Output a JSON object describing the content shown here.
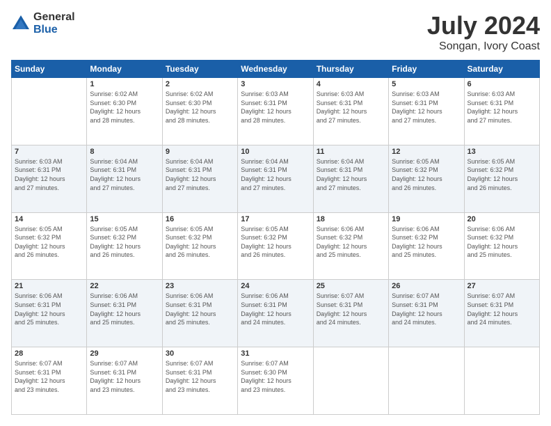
{
  "logo": {
    "general": "General",
    "blue": "Blue"
  },
  "title": "July 2024",
  "subtitle": "Songan, Ivory Coast",
  "weekdays": [
    "Sunday",
    "Monday",
    "Tuesday",
    "Wednesday",
    "Thursday",
    "Friday",
    "Saturday"
  ],
  "weeks": [
    [
      {
        "day": "",
        "info": ""
      },
      {
        "day": "1",
        "info": "Sunrise: 6:02 AM\nSunset: 6:30 PM\nDaylight: 12 hours\nand 28 minutes."
      },
      {
        "day": "2",
        "info": "Sunrise: 6:02 AM\nSunset: 6:30 PM\nDaylight: 12 hours\nand 28 minutes."
      },
      {
        "day": "3",
        "info": "Sunrise: 6:03 AM\nSunset: 6:31 PM\nDaylight: 12 hours\nand 28 minutes."
      },
      {
        "day": "4",
        "info": "Sunrise: 6:03 AM\nSunset: 6:31 PM\nDaylight: 12 hours\nand 27 minutes."
      },
      {
        "day": "5",
        "info": "Sunrise: 6:03 AM\nSunset: 6:31 PM\nDaylight: 12 hours\nand 27 minutes."
      },
      {
        "day": "6",
        "info": "Sunrise: 6:03 AM\nSunset: 6:31 PM\nDaylight: 12 hours\nand 27 minutes."
      }
    ],
    [
      {
        "day": "7",
        "info": "Sunrise: 6:03 AM\nSunset: 6:31 PM\nDaylight: 12 hours\nand 27 minutes."
      },
      {
        "day": "8",
        "info": "Sunrise: 6:04 AM\nSunset: 6:31 PM\nDaylight: 12 hours\nand 27 minutes."
      },
      {
        "day": "9",
        "info": "Sunrise: 6:04 AM\nSunset: 6:31 PM\nDaylight: 12 hours\nand 27 minutes."
      },
      {
        "day": "10",
        "info": "Sunrise: 6:04 AM\nSunset: 6:31 PM\nDaylight: 12 hours\nand 27 minutes."
      },
      {
        "day": "11",
        "info": "Sunrise: 6:04 AM\nSunset: 6:31 PM\nDaylight: 12 hours\nand 27 minutes."
      },
      {
        "day": "12",
        "info": "Sunrise: 6:05 AM\nSunset: 6:32 PM\nDaylight: 12 hours\nand 26 minutes."
      },
      {
        "day": "13",
        "info": "Sunrise: 6:05 AM\nSunset: 6:32 PM\nDaylight: 12 hours\nand 26 minutes."
      }
    ],
    [
      {
        "day": "14",
        "info": "Sunrise: 6:05 AM\nSunset: 6:32 PM\nDaylight: 12 hours\nand 26 minutes."
      },
      {
        "day": "15",
        "info": "Sunrise: 6:05 AM\nSunset: 6:32 PM\nDaylight: 12 hours\nand 26 minutes."
      },
      {
        "day": "16",
        "info": "Sunrise: 6:05 AM\nSunset: 6:32 PM\nDaylight: 12 hours\nand 26 minutes."
      },
      {
        "day": "17",
        "info": "Sunrise: 6:05 AM\nSunset: 6:32 PM\nDaylight: 12 hours\nand 26 minutes."
      },
      {
        "day": "18",
        "info": "Sunrise: 6:06 AM\nSunset: 6:32 PM\nDaylight: 12 hours\nand 25 minutes."
      },
      {
        "day": "19",
        "info": "Sunrise: 6:06 AM\nSunset: 6:32 PM\nDaylight: 12 hours\nand 25 minutes."
      },
      {
        "day": "20",
        "info": "Sunrise: 6:06 AM\nSunset: 6:32 PM\nDaylight: 12 hours\nand 25 minutes."
      }
    ],
    [
      {
        "day": "21",
        "info": "Sunrise: 6:06 AM\nSunset: 6:31 PM\nDaylight: 12 hours\nand 25 minutes."
      },
      {
        "day": "22",
        "info": "Sunrise: 6:06 AM\nSunset: 6:31 PM\nDaylight: 12 hours\nand 25 minutes."
      },
      {
        "day": "23",
        "info": "Sunrise: 6:06 AM\nSunset: 6:31 PM\nDaylight: 12 hours\nand 25 minutes."
      },
      {
        "day": "24",
        "info": "Sunrise: 6:06 AM\nSunset: 6:31 PM\nDaylight: 12 hours\nand 24 minutes."
      },
      {
        "day": "25",
        "info": "Sunrise: 6:07 AM\nSunset: 6:31 PM\nDaylight: 12 hours\nand 24 minutes."
      },
      {
        "day": "26",
        "info": "Sunrise: 6:07 AM\nSunset: 6:31 PM\nDaylight: 12 hours\nand 24 minutes."
      },
      {
        "day": "27",
        "info": "Sunrise: 6:07 AM\nSunset: 6:31 PM\nDaylight: 12 hours\nand 24 minutes."
      }
    ],
    [
      {
        "day": "28",
        "info": "Sunrise: 6:07 AM\nSunset: 6:31 PM\nDaylight: 12 hours\nand 23 minutes."
      },
      {
        "day": "29",
        "info": "Sunrise: 6:07 AM\nSunset: 6:31 PM\nDaylight: 12 hours\nand 23 minutes."
      },
      {
        "day": "30",
        "info": "Sunrise: 6:07 AM\nSunset: 6:31 PM\nDaylight: 12 hours\nand 23 minutes."
      },
      {
        "day": "31",
        "info": "Sunrise: 6:07 AM\nSunset: 6:30 PM\nDaylight: 12 hours\nand 23 minutes."
      },
      {
        "day": "",
        "info": ""
      },
      {
        "day": "",
        "info": ""
      },
      {
        "day": "",
        "info": ""
      }
    ]
  ]
}
